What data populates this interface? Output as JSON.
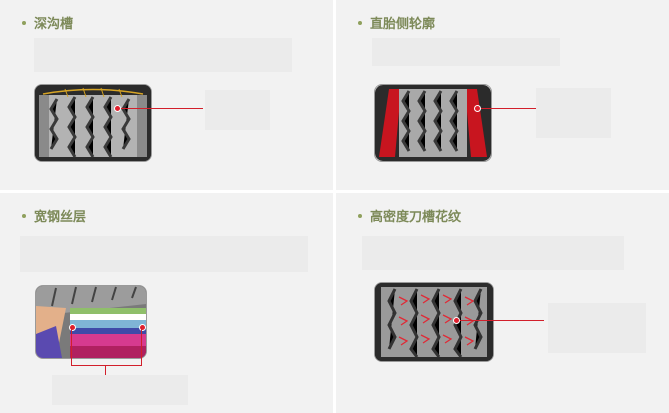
{
  "panels": {
    "deep_groove": {
      "title": "深沟槽",
      "icon": "tire-tread-icon"
    },
    "straight_sidewall": {
      "title": "直胎侧轮廓",
      "icon": "tire-sidewall-icon"
    },
    "steel_belt": {
      "title": "宽钢丝层",
      "icon": "tire-cross-section-icon"
    },
    "blade_pattern": {
      "title": "高密度刀槽花纹",
      "icon": "tire-siping-icon"
    }
  },
  "colors": {
    "title": "#7d8a59",
    "bullet": "#8fa05d",
    "callout": "#d21f2b",
    "panel_bg": "#f2f2f2"
  }
}
